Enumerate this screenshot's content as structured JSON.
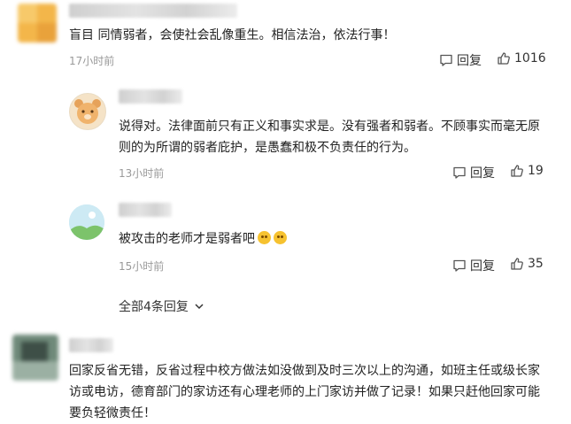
{
  "comments": [
    {
      "text": "盲目 同情弱者，会使社会乱像重生。相信法治，依法行事！",
      "time": "17小时前",
      "reply_label": "回复",
      "likes": "1016"
    },
    {
      "line1": "说得对。法律面前只有正义和事实求是。没有强者和弱者。不顾事实而毫无原",
      "line2": "则的为所谓的弱者庇护，是愚蠢和极不负责任的行为。",
      "time": "13小时前",
      "reply_label": "回复",
      "likes": "19"
    },
    {
      "text": "被攻击的老师才是弱者吧",
      "time": "15小时前",
      "reply_label": "回复",
      "likes": "35"
    },
    {
      "line1": "回家反省无错，反省过程中校方做法如没做到及时三次以上的沟通，如班主任或级长家",
      "line2": "访或电访，德育部门的家访还有心理老师的上门家访并做了记录！如果只赶他回家可能",
      "line3": "要负轻微责任！"
    }
  ],
  "expand_label": "全部4条回复",
  "icons": [
    "comment-icon",
    "thumb-up-icon",
    "chevron-down-icon",
    "cry-emoji-icon"
  ]
}
